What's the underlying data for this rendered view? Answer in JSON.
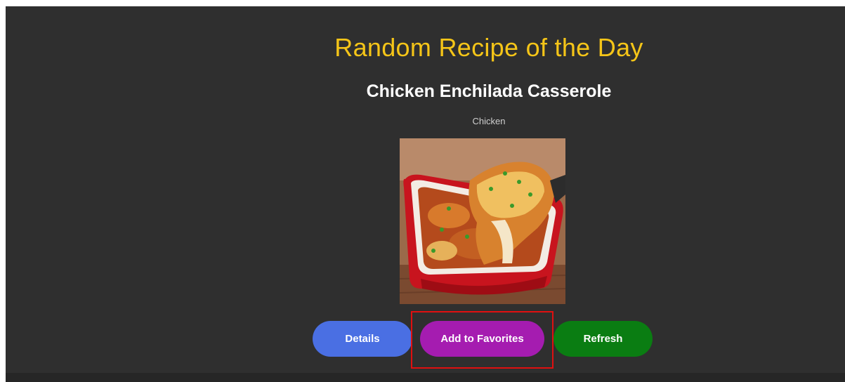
{
  "page": {
    "title": "Random Recipe of the Day"
  },
  "recipe": {
    "name": "Chicken Enchilada Casserole",
    "category": "Chicken",
    "image_description_icon": "casserole-photo"
  },
  "actions": {
    "details_label": "Details",
    "favorites_label": "Add to Favorites",
    "refresh_label": "Refresh"
  },
  "colors": {
    "background": "#2f2f2f",
    "title": "#f5c518",
    "details_button": "#4a6fe3",
    "favorites_button": "#a51cb0",
    "refresh_button": "#0a7d12",
    "highlight": "#e01010"
  }
}
